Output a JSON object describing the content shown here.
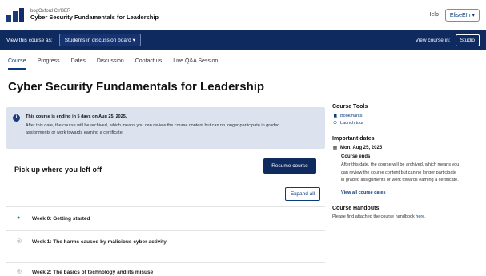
{
  "header": {
    "org_name": "bogOxford CYBER",
    "course_title": "Cyber Security Fundamentals for Leadership",
    "help": "Help",
    "user": "EliseEIn ▾"
  },
  "preview": {
    "view_as_label": "View this course as:",
    "view_as_value": "Students in discussion board ▾",
    "view_in_label": "View course in:",
    "studio": "Studio"
  },
  "tabs": [
    "Course",
    "Progress",
    "Dates",
    "Discussion",
    "Contact us",
    "Live Q&A Session"
  ],
  "main": {
    "title": "Cyber Security Fundamentals for Leadership",
    "alert_head": "This course is ending in 5 days on Aug 25, 2025.",
    "alert_body_1": "After this date, the course will be archived, which means you can review the course content but can no longer participate in graded",
    "alert_body_2": "assignments or work towards earning a certificate.",
    "resume_heading": "Pick up where you left off",
    "resume_button": "Resume course",
    "expand_button": "Expand all",
    "outline": [
      {
        "label": "Week 0: Getting started",
        "status": "complete"
      },
      {
        "label": "Week 1: The harms caused by malicious cyber activity",
        "status": "incomplete"
      },
      {
        "label": "Week 2: The basics of technology and its misuse",
        "status": "incomplete"
      }
    ]
  },
  "sidebar": {
    "tools_heading": "Course Tools",
    "bookmarks": "Bookmarks",
    "launch_tour": "Launch tour",
    "dates_heading": "Important dates",
    "date": "Mon, Aug 25, 2025",
    "event_title": "Course ends",
    "event_desc_1": "After this date, the course will be archived, which means you",
    "event_desc_2": "can review the course content but can no longer participate",
    "event_desc_3": "in graded assignments or work towards earning a certificate.",
    "view_all": "View all course dates",
    "handouts_heading": "Course Handouts",
    "handouts_text": "Please find attached the course handbook",
    "handouts_link": "here."
  }
}
